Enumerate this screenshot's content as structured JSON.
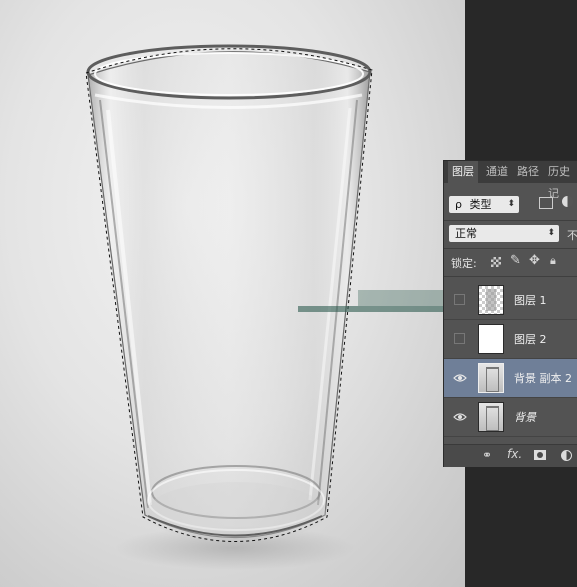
{
  "panel": {
    "tabs": [
      {
        "label": "图层"
      },
      {
        "label": "通道"
      },
      {
        "label": "路径"
      },
      {
        "label": "历史记"
      }
    ],
    "filter": {
      "search_glyph": "ρ",
      "label": "类型"
    },
    "blend": {
      "mode": "正常",
      "opacity_label": "不"
    },
    "lock": {
      "label": "锁定:"
    },
    "layers": [
      {
        "name": "图层 1",
        "visible": false,
        "selected": false,
        "thumb": "cutout"
      },
      {
        "name": "图层 2",
        "visible": false,
        "selected": false,
        "thumb": "white"
      },
      {
        "name": "背景 副本 2",
        "visible": true,
        "selected": true,
        "thumb": "glass"
      },
      {
        "name": "背景",
        "visible": true,
        "selected": false,
        "thumb": "glass"
      }
    ],
    "bottom_fx": "fx."
  },
  "colors": {
    "panel_bg": "#535353",
    "selected_layer": "#6f7f98",
    "dark_bg": "#282828"
  }
}
